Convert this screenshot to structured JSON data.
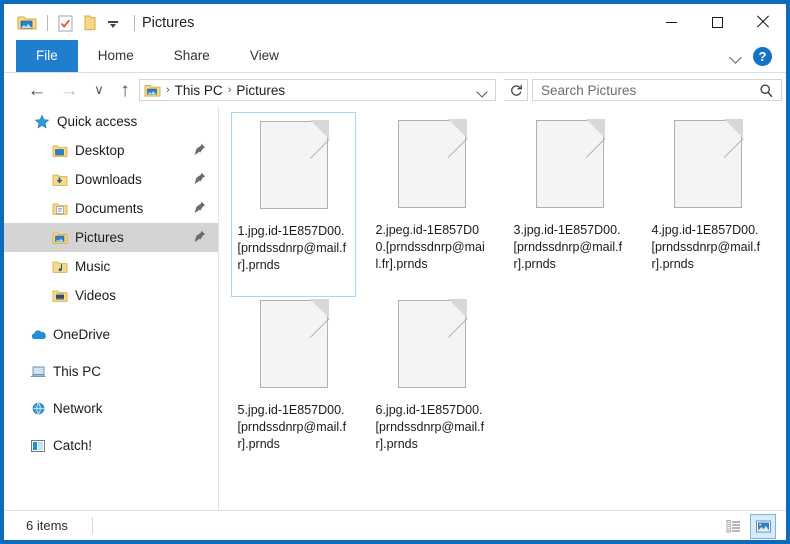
{
  "window": {
    "title": "Pictures",
    "quick_access_icons": [
      "pictures-folder-icon",
      "properties-icon",
      "new-folder-icon",
      "customize-dropdown-icon"
    ],
    "controls": {
      "minimize_label": "–",
      "maximize_label": "□",
      "close_label": "✕"
    }
  },
  "ribbon": {
    "tabs": [
      {
        "label": "File",
        "active": true
      },
      {
        "label": "Home",
        "active": false
      },
      {
        "label": "Share",
        "active": false
      },
      {
        "label": "View",
        "active": false
      }
    ],
    "collapse_icon": "chevron-down-icon",
    "help_label": "?"
  },
  "addressbar": {
    "back_glyph": "←",
    "forward_glyph": "→",
    "recent_glyph": "∨",
    "up_glyph": "↑",
    "crumbs": [
      "This PC",
      "Pictures"
    ],
    "separator": "›",
    "dropdown_icon": "chevron-down-icon",
    "refresh_icon": "refresh-icon",
    "search_placeholder": "Search Pictures",
    "search_value": "",
    "search_icon": "search-icon"
  },
  "navpane": {
    "items": [
      {
        "label": "Quick access",
        "icon": "star-icon",
        "indent": 0,
        "pinned": false,
        "selected": false
      },
      {
        "label": "Desktop",
        "icon": "desktop-folder-icon",
        "indent": 1,
        "pinned": true,
        "selected": false
      },
      {
        "label": "Downloads",
        "icon": "downloads-folder-icon",
        "indent": 1,
        "pinned": true,
        "selected": false
      },
      {
        "label": "Documents",
        "icon": "documents-folder-icon",
        "indent": 1,
        "pinned": true,
        "selected": false
      },
      {
        "label": "Pictures",
        "icon": "pictures-folder-icon",
        "indent": 1,
        "pinned": true,
        "selected": true
      },
      {
        "label": "Music",
        "icon": "music-folder-icon",
        "indent": 1,
        "pinned": false,
        "selected": false
      },
      {
        "label": "Videos",
        "icon": "videos-folder-icon",
        "indent": 1,
        "pinned": false,
        "selected": false
      },
      {
        "label": "OneDrive",
        "icon": "onedrive-cloud-icon",
        "indent": 0,
        "pinned": false,
        "selected": false
      },
      {
        "label": "This PC",
        "icon": "this-pc-icon",
        "indent": 0,
        "pinned": false,
        "selected": false
      },
      {
        "label": "Network",
        "icon": "network-icon",
        "indent": 0,
        "pinned": false,
        "selected": false
      },
      {
        "label": "Catch!",
        "icon": "catch-icon",
        "indent": 0,
        "pinned": false,
        "selected": false
      }
    ]
  },
  "files": [
    {
      "name": "1.jpg.id-1E857D00.[prndssdnrp@mail.fr].prnds",
      "selected": true
    },
    {
      "name": "2.jpeg.id-1E857D00.[prndssdnrp@mail.fr].prnds",
      "selected": false
    },
    {
      "name": "3.jpg.id-1E857D00.[prndssdnrp@mail.fr].prnds",
      "selected": false
    },
    {
      "name": "4.jpg.id-1E857D00.[prndssdnrp@mail.fr].prnds",
      "selected": false
    },
    {
      "name": "5.jpg.id-1E857D00.[prndssdnrp@mail.fr].prnds",
      "selected": false
    },
    {
      "name": "6.jpg.id-1E857D00.[prndssdnrp@mail.fr].prnds",
      "selected": false
    }
  ],
  "statusbar": {
    "item_count": "6 items",
    "views": [
      {
        "icon": "details-view-icon",
        "active": false
      },
      {
        "icon": "large-icons-view-icon",
        "active": true
      }
    ]
  },
  "colors": {
    "window_border": "#0a6cba",
    "active_tab": "#1f7fce",
    "selection_border": "#a8d8f0",
    "nav_selected": "#d4d4d4",
    "help_blue": "#1173c4"
  }
}
